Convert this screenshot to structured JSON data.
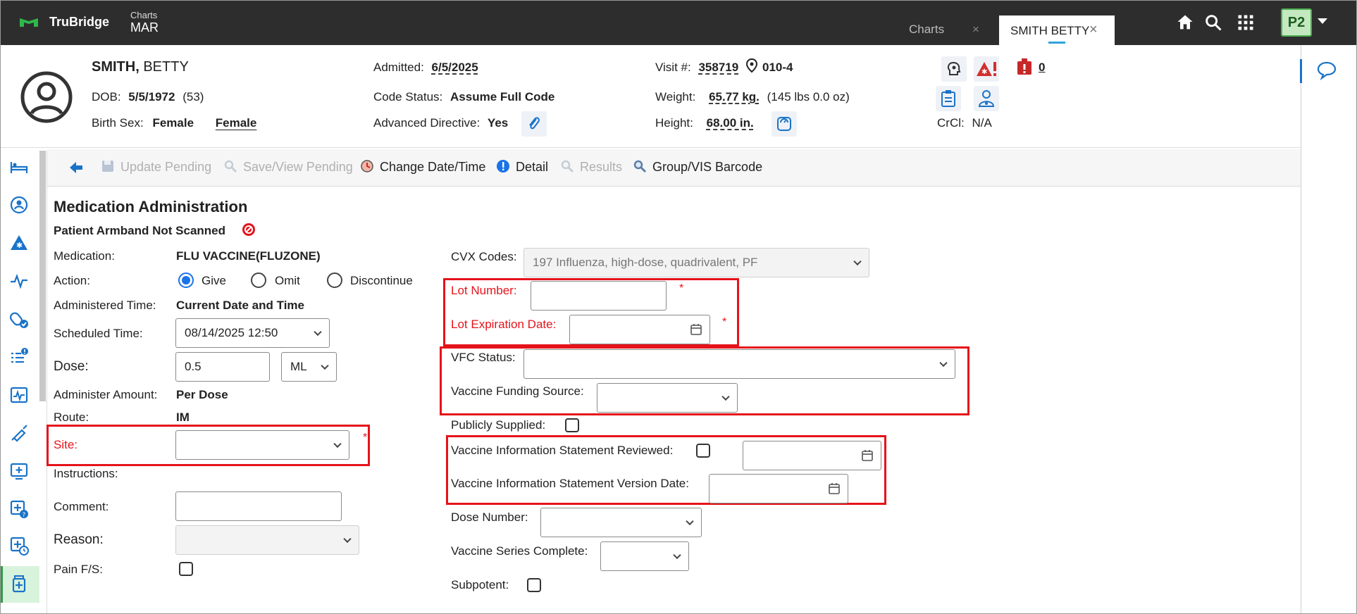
{
  "topbar": {
    "brand": "TruBridge",
    "crumb_small": "Charts",
    "crumb_big": "MAR",
    "tabs": [
      {
        "label": "Charts",
        "close": "×"
      },
      {
        "label": "SMITH BETTY",
        "close": "×"
      }
    ],
    "user_badge": "P2",
    "icons": [
      "home-icon",
      "search-icon",
      "apps-grid-icon"
    ]
  },
  "patient": {
    "last_name": "SMITH,",
    "first_name": "BETTY",
    "dob_label": "DOB:",
    "dob": "5/5/1972",
    "age": "(53)",
    "birth_sex_label": "Birth Sex:",
    "birth_sex": "Female",
    "gender": "Female",
    "admitted_label": "Admitted:",
    "admitted": "6/5/2025",
    "code_status_label": "Code Status:",
    "code_status": "Assume Full Code",
    "adv_directive_label": "Advanced Directive:",
    "adv_directive": "Yes",
    "visit_label": "Visit #:",
    "visit": "358719",
    "room": "010-4",
    "weight_label": "Weight:",
    "weight": "65.77 kg.",
    "weight_lbs": "(145 lbs 0.0 oz)",
    "height_label": "Height:",
    "height": "68.00 in.",
    "alerts_count": "0",
    "crcl_label": "CrCl:",
    "crcl": "N/A"
  },
  "toolbar": {
    "update_pending": "Update Pending",
    "save_view_pending": "Save/View Pending",
    "change_date_time": "Change Date/Time",
    "detail": "Detail",
    "results": "Results",
    "group_vis_barcode": "Group/VIS Barcode"
  },
  "form": {
    "title": "Medication Administration",
    "armband": "Patient Armband Not Scanned",
    "medication_label": "Medication:",
    "medication": "FLU VACCINE(FLUZONE)",
    "action_label": "Action:",
    "action_options": [
      "Give",
      "Omit",
      "Discontinue"
    ],
    "action_selected": "Give",
    "administered_time_label": "Administered Time:",
    "administered_time": "Current Date and Time",
    "scheduled_time_label": "Scheduled Time:",
    "scheduled_time": "08/14/2025 12:50",
    "dose_label": "Dose:",
    "dose": "0.5",
    "dose_unit": "ML",
    "administer_amount_label": "Administer Amount:",
    "administer_amount": "Per Dose",
    "route_label": "Route:",
    "route": "IM",
    "site_label": "Site:",
    "instructions_label": "Instructions:",
    "comment_label": "Comment:",
    "reason_label": "Reason:",
    "pain_label": "Pain F/S:",
    "cvx_label": "CVX Codes:",
    "cvx_value": "197 Influenza, high-dose, quadrivalent, PF",
    "lot_number_label": "Lot Number:",
    "lot_expiration_label": "Lot Expiration Date:",
    "vfc_status_label": "VFC Status:",
    "funding_source_label": "Vaccine Funding Source:",
    "publicly_supplied_label": "Publicly Supplied:",
    "vis_reviewed_label": "Vaccine Information Statement Reviewed:",
    "vis_version_date_label": "Vaccine Information Statement Version Date:",
    "dose_number_label": "Dose Number:",
    "series_complete_label": "Vaccine Series Complete:",
    "subpotent_label": "Subpotent:",
    "required_mark": "*"
  },
  "colors": {
    "topbar": "#2d2d2d",
    "accent_blue": "#1a73e8",
    "required_red": "#e5131a",
    "active_green": "#2e9a45"
  }
}
